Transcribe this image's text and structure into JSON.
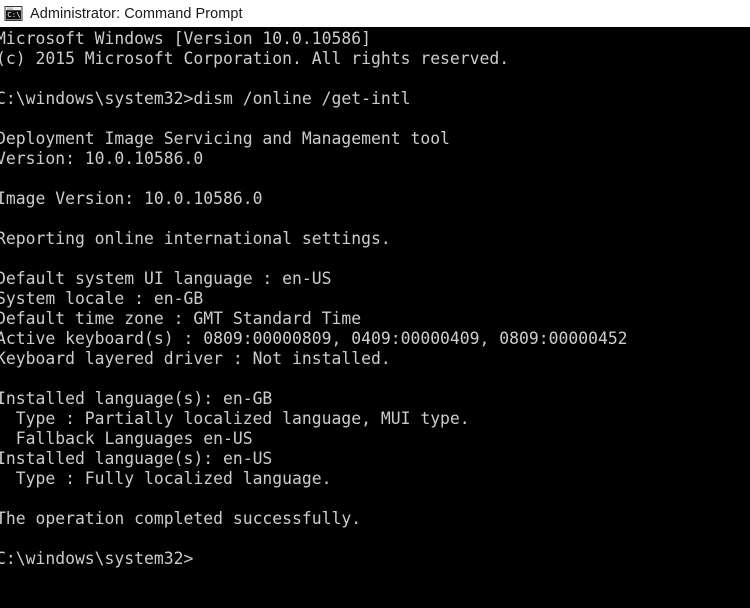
{
  "window": {
    "title": "Administrator: Command Prompt",
    "icon": "command-prompt-icon",
    "icon_label": "C:\\",
    "titlebar_background": "#ffffff",
    "titlebar_text_color": "#1a1a1a",
    "console_background": "#000000",
    "console_text_color": "#cccccc"
  },
  "console": {
    "lines": [
      "Microsoft Windows [Version 10.0.10586]",
      "(c) 2015 Microsoft Corporation. All rights reserved.",
      "",
      "C:\\windows\\system32>dism /online /get-intl",
      "",
      "Deployment Image Servicing and Management tool",
      "Version: 10.0.10586.0",
      "",
      "Image Version: 10.0.10586.0",
      "",
      "Reporting online international settings.",
      "",
      "Default system UI language : en-US",
      "System locale : en-GB",
      "Default time zone : GMT Standard Time",
      "Active keyboard(s) : 0809:00000809, 0409:00000409, 0809:00000452",
      "Keyboard layered driver : Not installed.",
      "",
      "Installed language(s): en-GB",
      "  Type : Partially localized language, MUI type.",
      "  Fallback Languages en-US",
      "Installed language(s): en-US",
      "  Type : Fully localized language.",
      "",
      "The operation completed successfully.",
      "",
      "C:\\windows\\system32>"
    ],
    "command": "dism /online /get-intl",
    "prompt": "C:\\windows\\system32>",
    "details": {
      "os_version": "Microsoft Windows [Version 10.0.10586]",
      "copyright": "(c) 2015 Microsoft Corporation. All rights reserved.",
      "tool_name": "Deployment Image Servicing and Management tool",
      "tool_version": "Version: 10.0.10586.0",
      "image_version": "Image Version: 10.0.10586.0",
      "report_header": "Reporting online international settings.",
      "default_ui_language": "en-US",
      "system_locale": "en-GB",
      "default_time_zone": "GMT Standard Time",
      "active_keyboards": "0809:00000809, 0409:00000409, 0809:00000452",
      "keyboard_layered_driver": "Not installed.",
      "installed_languages": [
        {
          "language": "en-GB",
          "type": "Partially localized language, MUI type.",
          "fallback_languages": "en-US"
        },
        {
          "language": "en-US",
          "type": "Fully localized language."
        }
      ],
      "result": "The operation completed successfully."
    }
  }
}
